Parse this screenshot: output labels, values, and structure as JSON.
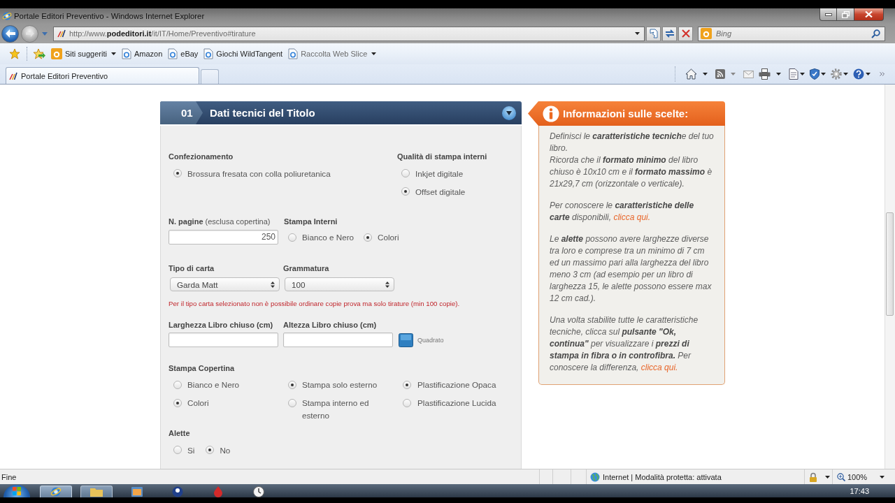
{
  "window": {
    "title": "Portale Editori Preventivo - Windows Internet Explorer"
  },
  "address_bar": {
    "url": "http://www.**podeditori.it**/it/IT/Home/Preventivo#tirature"
  },
  "search": {
    "placeholder": "Bing"
  },
  "favorites_bar": {
    "items": [
      {
        "kind": "suggested",
        "label": "Siti suggeriti"
      },
      {
        "kind": "link",
        "label": "Amazon"
      },
      {
        "kind": "link",
        "label": "eBay"
      },
      {
        "kind": "link",
        "label": "Giochi WildTangent"
      },
      {
        "kind": "gallery",
        "label": "Raccolta Web Slice"
      }
    ]
  },
  "tabs": [
    {
      "label": "Portale Editori Preventivo",
      "selected": true
    }
  ],
  "form_panel": {
    "step": "01",
    "title": "Dati tecnici del Titolo",
    "binding": {
      "label": "Confezionamento",
      "options": [
        {
          "label": "Brossura fresata con colla poliuretanica",
          "selected": true
        }
      ]
    },
    "print_quality": {
      "label": "Qualità di stampa interni",
      "options": [
        {
          "label": "Inkjet digitale",
          "selected": false
        },
        {
          "label": "Offset digitale",
          "selected": true
        }
      ]
    },
    "pages": {
      "label": "**N. pagine** (esclusa copertina)",
      "value": "250"
    },
    "interior_print": {
      "label": "Stampa Interni",
      "options": [
        {
          "label": "Bianco e Nero",
          "selected": false
        },
        {
          "label": "Colori",
          "selected": true
        }
      ]
    },
    "paper_type": {
      "label": "Tipo di carta",
      "value": "Garda Matt"
    },
    "paper_weight": {
      "label": "Grammatura",
      "value": "100"
    },
    "warning": "Per il tipo carta selezionato non è possibile ordinare copie prova ma solo tirature (min 100 copie).",
    "book_width": {
      "label": "Larghezza Libro chiuso (cm)"
    },
    "book_height": {
      "label": "Altezza Libro chiuso (cm)"
    },
    "square_option": {
      "label": "Quadrato"
    },
    "cover_print": {
      "label": "Stampa Copertina",
      "columns": [
        [
          {
            "label": "Bianco e Nero",
            "selected": false
          },
          {
            "label": "Colori",
            "selected": true
          }
        ],
        [
          {
            "label": "Stampa solo esterno",
            "selected": true
          },
          {
            "label": "Stampa interno ed esterno",
            "selected": false
          }
        ],
        [
          {
            "label": "Plastificazione Opaca",
            "selected": true
          },
          {
            "label": "Plastificazione Lucida",
            "selected": false
          }
        ]
      ]
    },
    "flaps": {
      "label": "Alette",
      "options": [
        {
          "label": "Si",
          "selected": false
        },
        {
          "label": "No",
          "selected": true
        }
      ]
    }
  },
  "info_panel": {
    "title": "Informazioni sulle scelte:",
    "paragraphs": [
      {
        "lines": [
          [
            {
              "kind": "text",
              "text": "Definisci le **caratteristiche tecnich**e del tuo libro."
            }
          ],
          [
            {
              "kind": "text",
              "text": "Ricorda che il **formato minimo** del libro chiuso è 10x10 cm e il **formato massimo** è 21x29,7 cm (orizzontale o verticale)."
            }
          ]
        ]
      },
      {
        "lines": [
          [
            {
              "kind": "text",
              "text": "Per conoscere le **caratteristiche delle carte** disponibili, "
            },
            {
              "kind": "link",
              "text": "clicca qui."
            }
          ]
        ]
      },
      {
        "lines": [
          [
            {
              "kind": "text",
              "text": "Le **alette** possono avere larghezze diverse tra loro e comprese tra un minimo di 7 cm ed un massimo pari alla larghezza del libro meno 3 cm (ad esempio per un libro di larghezza 15, le alette possono essere max 12 cm cad.)."
            }
          ]
        ]
      },
      {
        "lines": [
          [
            {
              "kind": "text",
              "text": "Una volta stabilite tutte le caratteristiche tecniche, clicca sul **pulsante \"Ok, continua\"** per visualizzare i **prezzi di stampa in fibra o in controfibra.** Per conoscere la differenza, "
            },
            {
              "kind": "link",
              "text": "clicca qui."
            }
          ]
        ]
      }
    ]
  },
  "status_bar": {
    "status": "Fine",
    "zone": "Internet | Modalità protetta: attivata",
    "zoom": "100%"
  },
  "taskbar": {
    "time": "17:43"
  }
}
